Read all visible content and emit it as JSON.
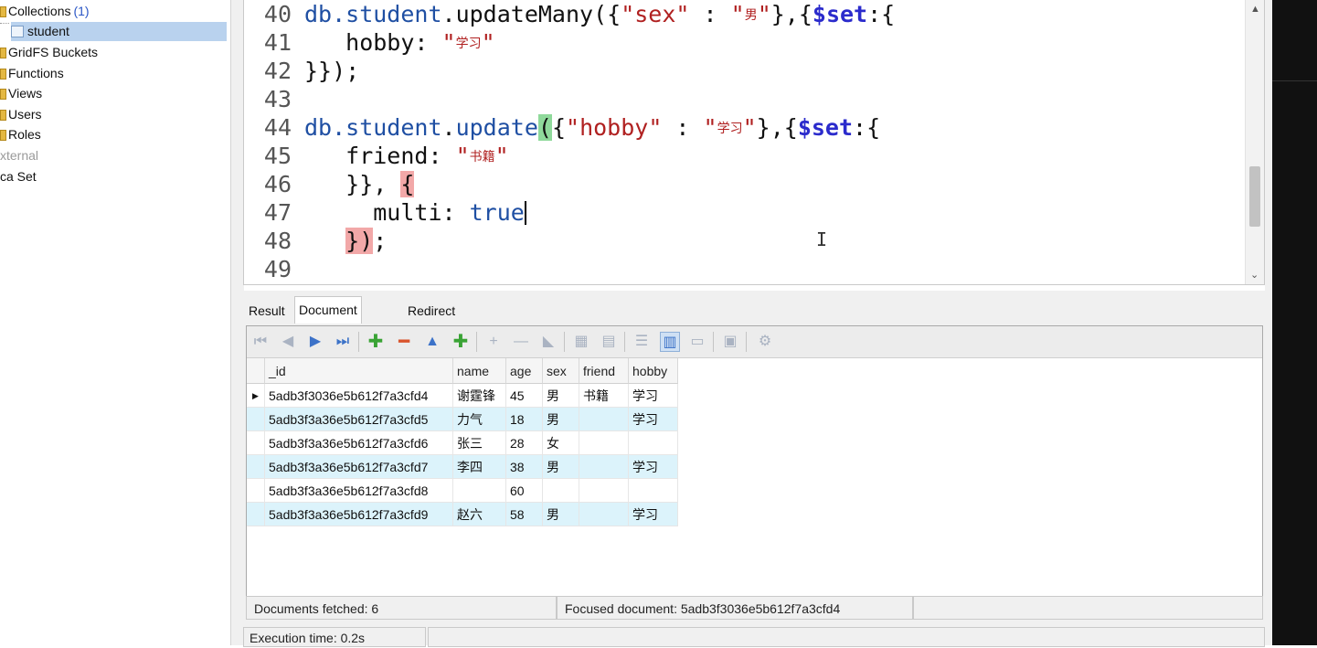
{
  "sidebar": {
    "items": [
      {
        "label": "Collections",
        "count": "(1)"
      },
      {
        "label": "student"
      },
      {
        "label": "GridFS Buckets"
      },
      {
        "label": "Functions"
      },
      {
        "label": "Views"
      },
      {
        "label": "Users"
      },
      {
        "label": "Roles"
      },
      {
        "label": "xternal"
      },
      {
        "label": "ca Set"
      }
    ]
  },
  "editor": {
    "line_numbers": [
      "40",
      "41",
      "42",
      "43",
      "44",
      "45",
      "46",
      "47",
      "48",
      "49"
    ],
    "l40": {
      "a": "db.",
      "b": "student",
      "c": ".",
      "d": "updateMany",
      "e": "({",
      "f": "\"sex\"",
      "g": " : ",
      "h": "\"",
      "i": "男",
      "j": "\"",
      "k": "},{",
      "l": "$set",
      "m": ":{"
    },
    "l41": {
      "a": "   hobby: ",
      "b": "\"",
      "c": "学习",
      "d": "\""
    },
    "l42": {
      "a": "}});"
    },
    "l44": {
      "a": "db.",
      "b": "student",
      "c": ".",
      "d": "update",
      "e": "(",
      "f": "{",
      "g": "\"hobby\"",
      "h": " : ",
      "i": "\"",
      "j": "学习",
      "k": "\"",
      "l": "},{",
      "m": "$set",
      "n": ":{"
    },
    "l45": {
      "a": "   friend: ",
      "b": "\"",
      "c": "书籍",
      "d": "\""
    },
    "l46": {
      "a": "   }}, ",
      "b": "{"
    },
    "l47": {
      "a": "     multi: ",
      "b": "true"
    },
    "l48": {
      "a": "   ",
      "b": "})",
      "c": ";"
    },
    "ibeam": "I"
  },
  "tabs": [
    {
      "label": "Result"
    },
    {
      "label": "Document view"
    },
    {
      "label": "Redirect to File"
    }
  ],
  "toolbar": {
    "icons": [
      "first-icon",
      "prev-icon",
      "next-icon",
      "last-icon",
      "add-icon",
      "remove-icon",
      "up-icon",
      "add-child-icon",
      "insert-icon",
      "minus-icon",
      "chart-icon",
      "grid1-icon",
      "grid2-icon",
      "tree-icon",
      "table-view-icon",
      "text-view-icon",
      "export-icon",
      "settings-icon"
    ],
    "glyphs": {
      "first": "⏮",
      "prev": "◀",
      "next": "▶",
      "last": "⏭",
      "add": "✚",
      "remove": "━",
      "up": "▲",
      "add_child": "✚",
      "insert": "+",
      "minus": "—",
      "chart": "◣",
      "grid1": "▦",
      "grid2": "▤",
      "tree": "☰",
      "table_view": "▥",
      "text_view": "▭",
      "export": "▣",
      "settings": "⚙"
    }
  },
  "grid": {
    "headers": [
      "_id",
      "name",
      "age",
      "sex",
      "friend",
      "hobby"
    ],
    "rows": [
      {
        "_id": "5adb3f3036e5b612f7a3cfd4",
        "name": "谢霆锋",
        "age": "45",
        "sex": "男",
        "friend": "书籍",
        "hobby": "学习",
        "marker": "▶"
      },
      {
        "_id": "5adb3f3a36e5b612f7a3cfd5",
        "name": "力气",
        "age": "18",
        "sex": "男",
        "friend": "",
        "hobby": "学习",
        "marker": ""
      },
      {
        "_id": "5adb3f3a36e5b612f7a3cfd6",
        "name": "张三",
        "age": "28",
        "sex": "女",
        "friend": "",
        "hobby": "",
        "marker": ""
      },
      {
        "_id": "5adb3f3a36e5b612f7a3cfd7",
        "name": "李四",
        "age": "38",
        "sex": "男",
        "friend": "",
        "hobby": "学习",
        "marker": ""
      },
      {
        "_id": "5adb3f3a36e5b612f7a3cfd8",
        "name": "",
        "age": "60",
        "sex": "",
        "friend": "",
        "hobby": "",
        "marker": ""
      },
      {
        "_id": "5adb3f3a36e5b612f7a3cfd9",
        "name": "赵六",
        "age": "58",
        "sex": "男",
        "friend": "",
        "hobby": "学习",
        "marker": ""
      }
    ]
  },
  "status": {
    "fetched": "Documents fetched: 6",
    "focused": "Focused document: 5adb3f3036e5b612f7a3cfd4",
    "execution": "Execution time: 0.2s"
  },
  "scroll": {
    "up": "▲",
    "down": "⌄"
  }
}
